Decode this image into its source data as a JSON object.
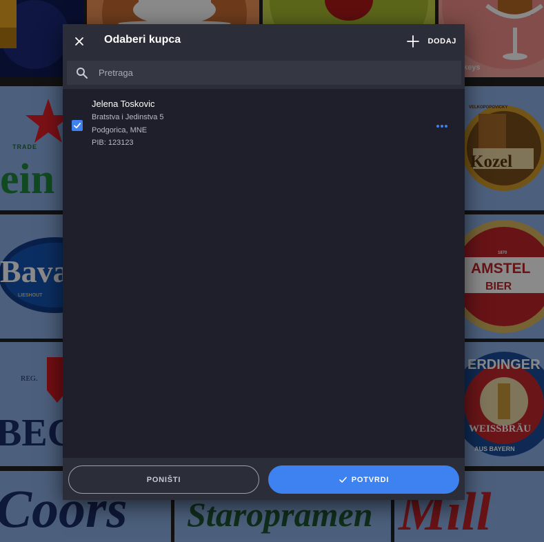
{
  "dialog": {
    "title": "Odaberi kupca",
    "add_label": "DODAJ",
    "close_icon": "close-icon",
    "add_icon": "plus-icon"
  },
  "search": {
    "placeholder": "Pretraga",
    "value": "",
    "icon": "search-icon"
  },
  "customers": [
    {
      "name": "Jelena Toskovic",
      "address": "Bratstva i Jedinstva 5",
      "city": "Podgorica, MNE",
      "pib": "PIB: 123123",
      "selected": true
    }
  ],
  "footer": {
    "cancel_label": "PONIŠTI",
    "confirm_label": "POTVRDI"
  },
  "background": {
    "tiles": [
      {
        "visible_text": "keys"
      },
      {
        "visible_text": "TRADE"
      },
      {
        "visible_text": "Kozel"
      },
      {
        "visible_text": "VELKOPOPOVICKY"
      },
      {
        "visible_text": "Bava"
      },
      {
        "visible_text": "LIESHOUT"
      },
      {
        "visible_text": "AMSTEL"
      },
      {
        "visible_text": "BIER"
      },
      {
        "visible_text": "1870"
      },
      {
        "visible_text": "REG."
      },
      {
        "visible_text": "ERDINGER"
      },
      {
        "visible_text": "WEISSBRÄU"
      },
      {
        "visible_text": "AUS BAYERN"
      },
      {
        "visible_text": "Coors"
      },
      {
        "visible_text": "Staropramen"
      },
      {
        "visible_text": "Mill"
      }
    ]
  },
  "colors": {
    "accent": "#3d82f0",
    "dialog_bg": "#1e1f2a",
    "header_bg": "#2b2d38"
  }
}
